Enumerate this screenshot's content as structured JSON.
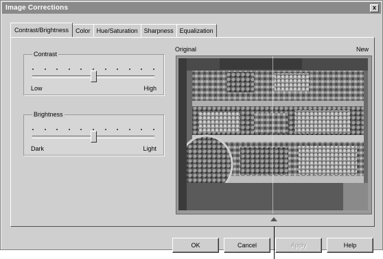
{
  "window": {
    "title": "Image Corrections",
    "close_label": "x"
  },
  "tabs": [
    {
      "label": "Contrast/Brightness",
      "active": true
    },
    {
      "label": "Color",
      "active": false
    },
    {
      "label": "Hue/Saturation",
      "active": false
    },
    {
      "label": "Sharpness",
      "active": false
    },
    {
      "label": "Equalization",
      "active": false
    }
  ],
  "contrast": {
    "legend": "Contrast",
    "min_label": "Low",
    "max_label": "High",
    "value_fraction": 0.5
  },
  "brightness": {
    "legend": "Brightness",
    "min_label": "Dark",
    "max_label": "Light",
    "value_fraction": 0.5
  },
  "preview": {
    "original_label": "Original",
    "new_label": "New"
  },
  "buttons": {
    "ok": "OK",
    "cancel": "Cancel",
    "apply": "Apply",
    "help": "Help"
  }
}
